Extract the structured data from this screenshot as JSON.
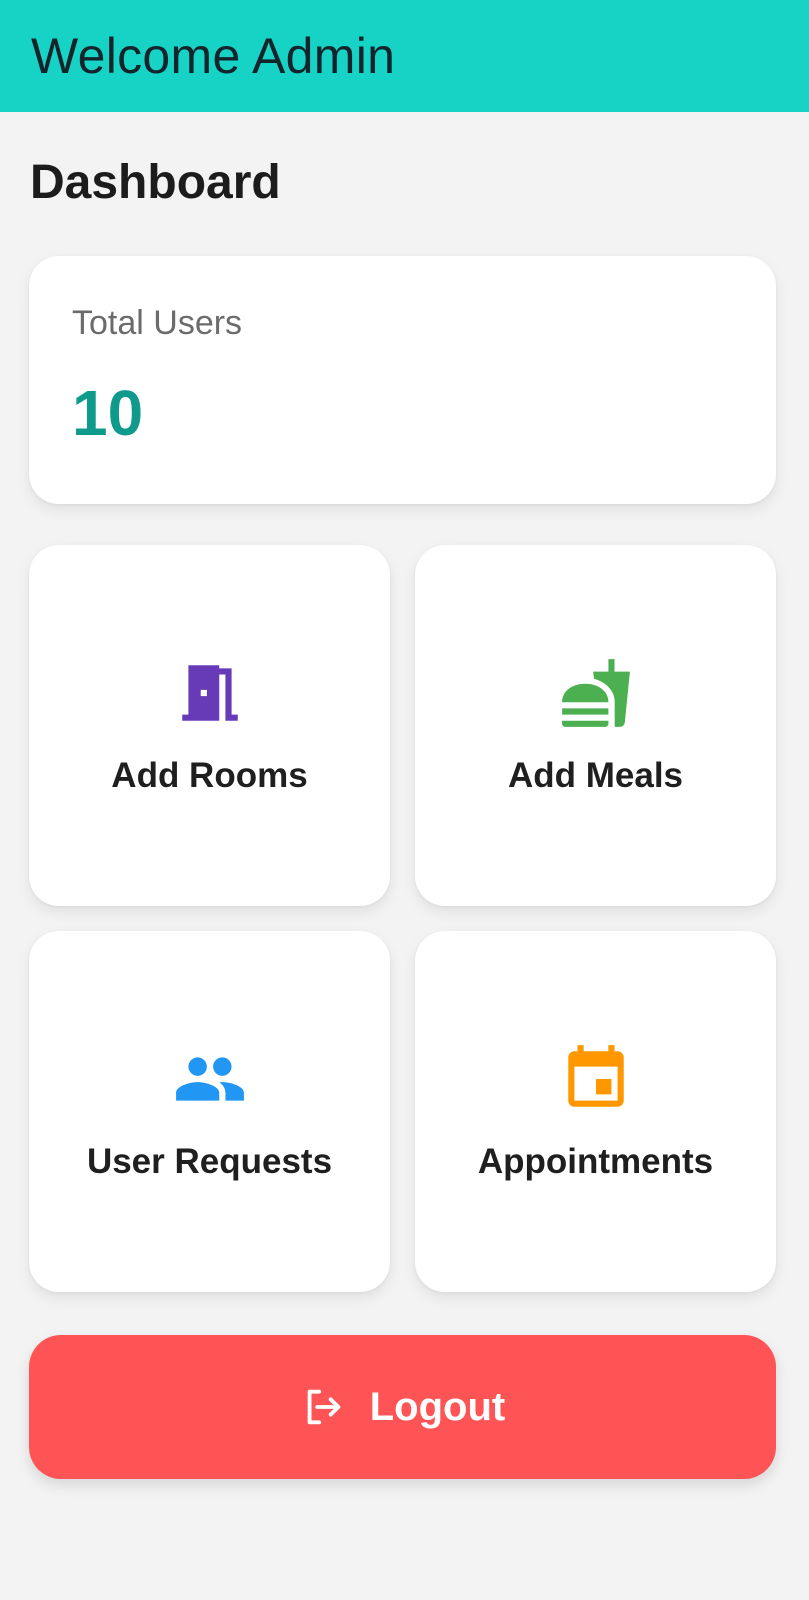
{
  "app_bar": {
    "title": "Welcome Admin",
    "color": "#16d3c6"
  },
  "page": {
    "title": "Dashboard"
  },
  "stats": {
    "total_users_label": "Total Users",
    "total_users_value": "10",
    "value_color": "#0f9a8c"
  },
  "tiles": [
    {
      "label": "Add Rooms",
      "icon": "door-icon",
      "color": "#673ab7"
    },
    {
      "label": "Add Meals",
      "icon": "fastfood-icon",
      "color": "#4caf50"
    },
    {
      "label": "User Requests",
      "icon": "people-icon",
      "color": "#2196f3"
    },
    {
      "label": "Appointments",
      "icon": "calendar-icon",
      "color": "#ff9800"
    }
  ],
  "logout": {
    "label": "Logout",
    "icon": "logout-icon",
    "color": "#ff5456"
  }
}
